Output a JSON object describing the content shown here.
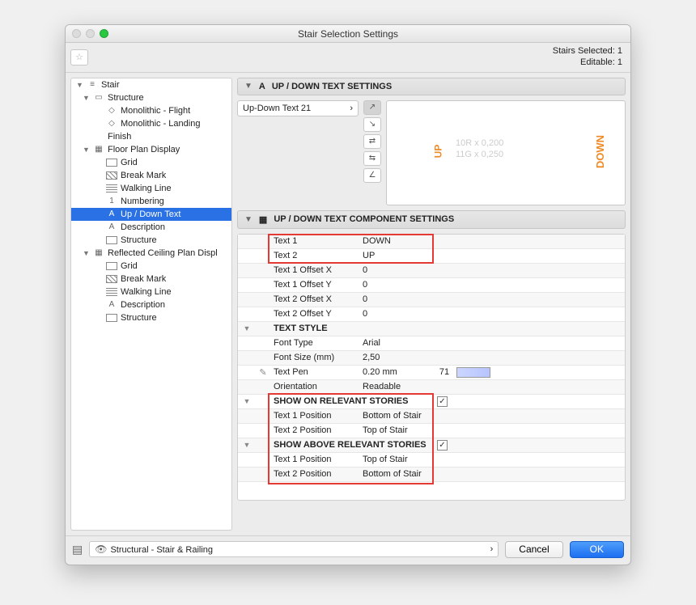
{
  "window": {
    "title": "Stair Selection Settings"
  },
  "status": {
    "selected": "Stairs Selected: 1",
    "editable": "Editable: 1"
  },
  "tree": {
    "stair": "Stair",
    "structure": "Structure",
    "mono_flight": "Monolithic - Flight",
    "mono_landing": "Monolithic - Landing",
    "finish": "Finish",
    "fpd": "Floor Plan Display",
    "fpd_grid": "Grid",
    "fpd_break": "Break Mark",
    "fpd_walk": "Walking Line",
    "fpd_num": "Numbering",
    "fpd_updown": "Up / Down Text",
    "fpd_desc": "Description",
    "fpd_struct": "Structure",
    "rcp": "Reflected Ceiling Plan Displ",
    "rcp_grid": "Grid",
    "rcp_break": "Break Mark",
    "rcp_walk": "Walking Line",
    "rcp_desc": "Description",
    "rcp_struct": "Structure"
  },
  "panels": {
    "settings_title": "UP / DOWN TEXT SETTINGS",
    "component_title": "UP / DOWN TEXT COMPONENT SETTINGS"
  },
  "preset": "Up-Down Text 21",
  "preview": {
    "up": "UP",
    "down": "DOWN",
    "l1": "10R x 0,200",
    "l2": "11G x 0,250"
  },
  "params": {
    "text1_label": "Text 1",
    "text1_value": "DOWN",
    "text2_label": "Text 2",
    "text2_value": "UP",
    "t1ox_label": "Text 1 Offset X",
    "t1ox_value": "0",
    "t1oy_label": "Text 1 Offset Y",
    "t1oy_value": "0",
    "t2ox_label": "Text 2 Offset X",
    "t2ox_value": "0",
    "t2oy_label": "Text 2 Offset Y",
    "t2oy_value": "0",
    "textstyle": "TEXT STYLE",
    "font_label": "Font Type",
    "font_value": "Arial",
    "size_label": "Font Size (mm)",
    "size_value": "2,50",
    "pen_label": "Text Pen",
    "pen_value": "0.20 mm",
    "pen_index": "71",
    "orient_label": "Orientation",
    "orient_value": "Readable",
    "show_on": "SHOW ON RELEVANT STORIES",
    "t1pos_label": "Text 1 Position",
    "t1pos_value_on": "Bottom of Stair",
    "t2pos_label": "Text 2 Position",
    "t2pos_value_on": "Top of Stair",
    "show_above": "SHOW ABOVE RELEVANT STORIES",
    "t1pos_value_ab": "Top of Stair",
    "t2pos_value_ab": "Bottom of Stair"
  },
  "footer": {
    "layer": "Structural - Stair & Railing",
    "cancel": "Cancel",
    "ok": "OK"
  }
}
